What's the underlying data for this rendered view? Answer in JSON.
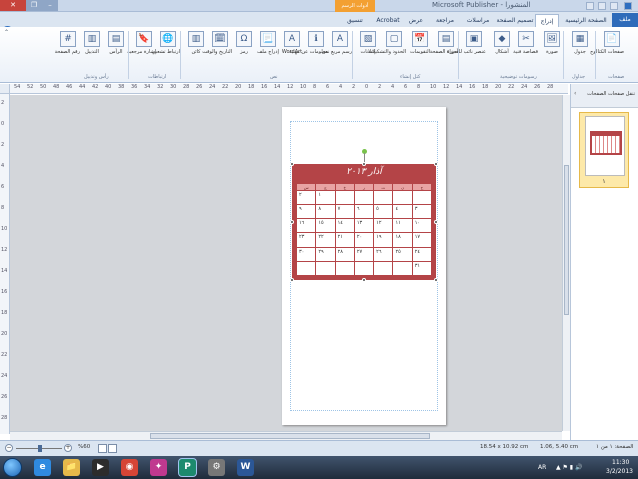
{
  "window": {
    "title": "المنشورا - Microsoft Publisher",
    "context_tab": "أدوات الرسم",
    "controls": {
      "close": "✕",
      "maximize": "❐",
      "minimize": "–"
    }
  },
  "ribbon": {
    "file_tab": "ملف",
    "tabs": [
      "الصفحة الرئيسية",
      "إدراج",
      "تصميم الصفحة",
      "مراسلات",
      "مراجعة",
      "عرض",
      "Acrobat",
      "تنسيق"
    ],
    "active_tab": "إدراج",
    "buttons": [
      {
        "id": "page-parts",
        "label": "صفحات الكتالوج",
        "icon": "📄"
      },
      {
        "id": "table",
        "label": "جدول",
        "icon": "▦"
      },
      {
        "id": "picture",
        "label": "صورة",
        "icon": "🖼"
      },
      {
        "id": "clip-art",
        "label": "قصاصة فنية",
        "icon": "✂"
      },
      {
        "id": "shapes",
        "label": "أشكال",
        "icon": "◆"
      },
      {
        "id": "picture-placeholder",
        "label": "عنصر نائب للصورة",
        "icon": "▣"
      },
      {
        "id": "page-parts2",
        "label": "أجزاء الصفحة",
        "icon": "▤"
      },
      {
        "id": "calendars",
        "label": "التقويمات",
        "icon": "📅"
      },
      {
        "id": "borders",
        "label": "الحدود والتشكيلات",
        "icon": "▢"
      },
      {
        "id": "ads",
        "label": "إعلانات",
        "icon": "▧"
      },
      {
        "id": "draw-textbox",
        "label": "رسم مربع نص",
        "icon": "A"
      },
      {
        "id": "business-info",
        "label": "معلومات عن مهنية",
        "icon": "ℹ"
      },
      {
        "id": "wordart",
        "label": "WordArt",
        "icon": "A"
      },
      {
        "id": "insert-file",
        "label": "إدراج ملف",
        "icon": "📃"
      },
      {
        "id": "symbol",
        "label": "رمز",
        "icon": "Ω"
      },
      {
        "id": "date-time",
        "label": "التاريخ والوقت",
        "icon": "🗓"
      },
      {
        "id": "object",
        "label": "كائن",
        "icon": "▥"
      },
      {
        "id": "hyperlink",
        "label": "ارتباط تشعبي",
        "icon": "🌐"
      },
      {
        "id": "bookmark",
        "label": "إشارة مرجعية",
        "icon": "🔖"
      },
      {
        "id": "header",
        "label": "الرأس",
        "icon": "▤"
      },
      {
        "id": "footer",
        "label": "التذييل",
        "icon": "▥"
      },
      {
        "id": "page-number",
        "label": "رقم الصفحة",
        "icon": "#"
      }
    ],
    "groups": [
      "صفحات",
      "جداول",
      "رسومات توضيحية",
      "كتل إنشاء",
      "نص",
      "ارتباطات",
      "رأس وتذييل"
    ]
  },
  "ruler": {
    "h_numbers": [
      "54",
      "52",
      "50",
      "48",
      "46",
      "44",
      "42",
      "40",
      "38",
      "36",
      "34",
      "32",
      "30",
      "28",
      "26",
      "24",
      "22",
      "20",
      "18",
      "16",
      "14",
      "12",
      "10",
      "8",
      "6",
      "4",
      "2",
      "0",
      "2",
      "4",
      "6",
      "8",
      "10",
      "12",
      "14",
      "16",
      "18",
      "20",
      "22",
      "24",
      "26",
      "28"
    ],
    "v_numbers": [
      "2",
      "0",
      "2",
      "4",
      "6",
      "8",
      "10",
      "12",
      "14",
      "16",
      "18",
      "20",
      "22",
      "24",
      "26",
      "28"
    ]
  },
  "calendar": {
    "title": "آذار ٢٠١٣",
    "weekdays": [
      "ح",
      "ن",
      "ث",
      "ر",
      "خ",
      "ج",
      "س"
    ],
    "weeks": [
      [
        "",
        "",
        "",
        "",
        "",
        "١",
        "٢"
      ],
      [
        "٣",
        "٤",
        "٥",
        "٦",
        "٧",
        "٨",
        "٩"
      ],
      [
        "١٠",
        "١١",
        "١٢",
        "١٣",
        "١٤",
        "١٥",
        "١٦"
      ],
      [
        "١٧",
        "١٨",
        "١٩",
        "٢٠",
        "٢١",
        "٢٢",
        "٢٣"
      ],
      [
        "٢٤",
        "٢٥",
        "٢٦",
        "٢٧",
        "٢٨",
        "٢٩",
        "٣٠"
      ],
      [
        "٣١",
        "",
        "",
        "",
        "",
        "",
        ""
      ]
    ]
  },
  "nav_pane": {
    "title": "تنقل صفحات الصفحات",
    "page_number": "١"
  },
  "status": {
    "page": "الصفحة: ١ من ١",
    "position": "1.06, 5.40 cm",
    "size": "18.54 x 10.92 cm",
    "zoom": "%60"
  },
  "taskbar": {
    "apps": [
      {
        "id": "ie",
        "glyph": "e",
        "color": "#2f8ae0"
      },
      {
        "id": "explorer",
        "glyph": "📁",
        "color": "#e6b94a"
      },
      {
        "id": "media",
        "glyph": "▶",
        "color": "#2c2c2c"
      },
      {
        "id": "chrome",
        "glyph": "◉",
        "color": "#d64536"
      },
      {
        "id": "paint",
        "glyph": "✦",
        "color": "#c0398f"
      },
      {
        "id": "publisher",
        "glyph": "P",
        "color": "#1c8a6e"
      },
      {
        "id": "tool",
        "glyph": "⚙",
        "color": "#777"
      },
      {
        "id": "word",
        "glyph": "W",
        "color": "#2b5797"
      }
    ],
    "lang": "AR",
    "time": "11:30",
    "date": "3/2/2013"
  }
}
